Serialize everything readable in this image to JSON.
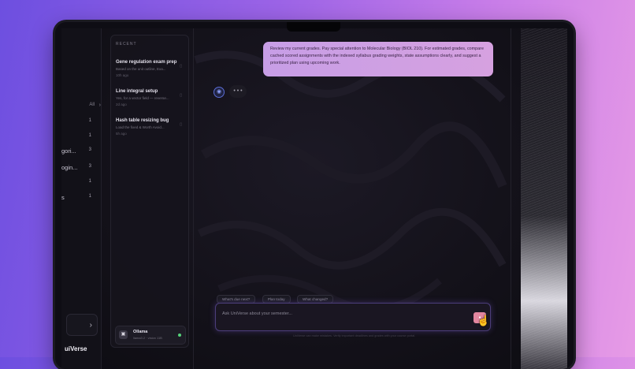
{
  "rail": {
    "all_label": "All",
    "ticks": [
      "1",
      "1",
      "3",
      "3",
      "1",
      "1"
    ],
    "labels": [
      "gori...",
      "ogin...",
      "s"
    ],
    "brand": "uiVerse"
  },
  "history": {
    "heading": "RECENT",
    "items": [
      {
        "title": "Gene regulation exam prep",
        "preview": "Based on the unit outline, Exa...",
        "age": "10h ago"
      },
      {
        "title": "Line integral setup",
        "preview": "Yes, for a vector field — reverse...",
        "age": "2d ago"
      },
      {
        "title": "Hash table resizing bug",
        "preview": "Load the fixed & Worth Avoid...",
        "age": "5h ago"
      }
    ],
    "model": {
      "name": "Ollama",
      "status": "llama3.2 · vision 11B"
    }
  },
  "chat": {
    "user_message": "Review my current grades. Pay special attention to Molecular Biology (BIOL 210). For estimated grades, compare cached scored assignments with the indexed syllabus grading weights, state assumptions clearly, and suggest a prioritized plan using upcoming work.",
    "typing": "• • •",
    "chips": [
      "What's due next?",
      "Plan today",
      "What changed?"
    ],
    "placeholder": "Ask UniVerse about your semester...",
    "disclaimer": "UniVerse can make mistakes. Verify important deadlines and grades with your course portal."
  },
  "colors": {
    "accent": "#c79ee6",
    "send": "#e2869f",
    "background_start": "#6d4fe0",
    "background_end": "#e79be6"
  }
}
